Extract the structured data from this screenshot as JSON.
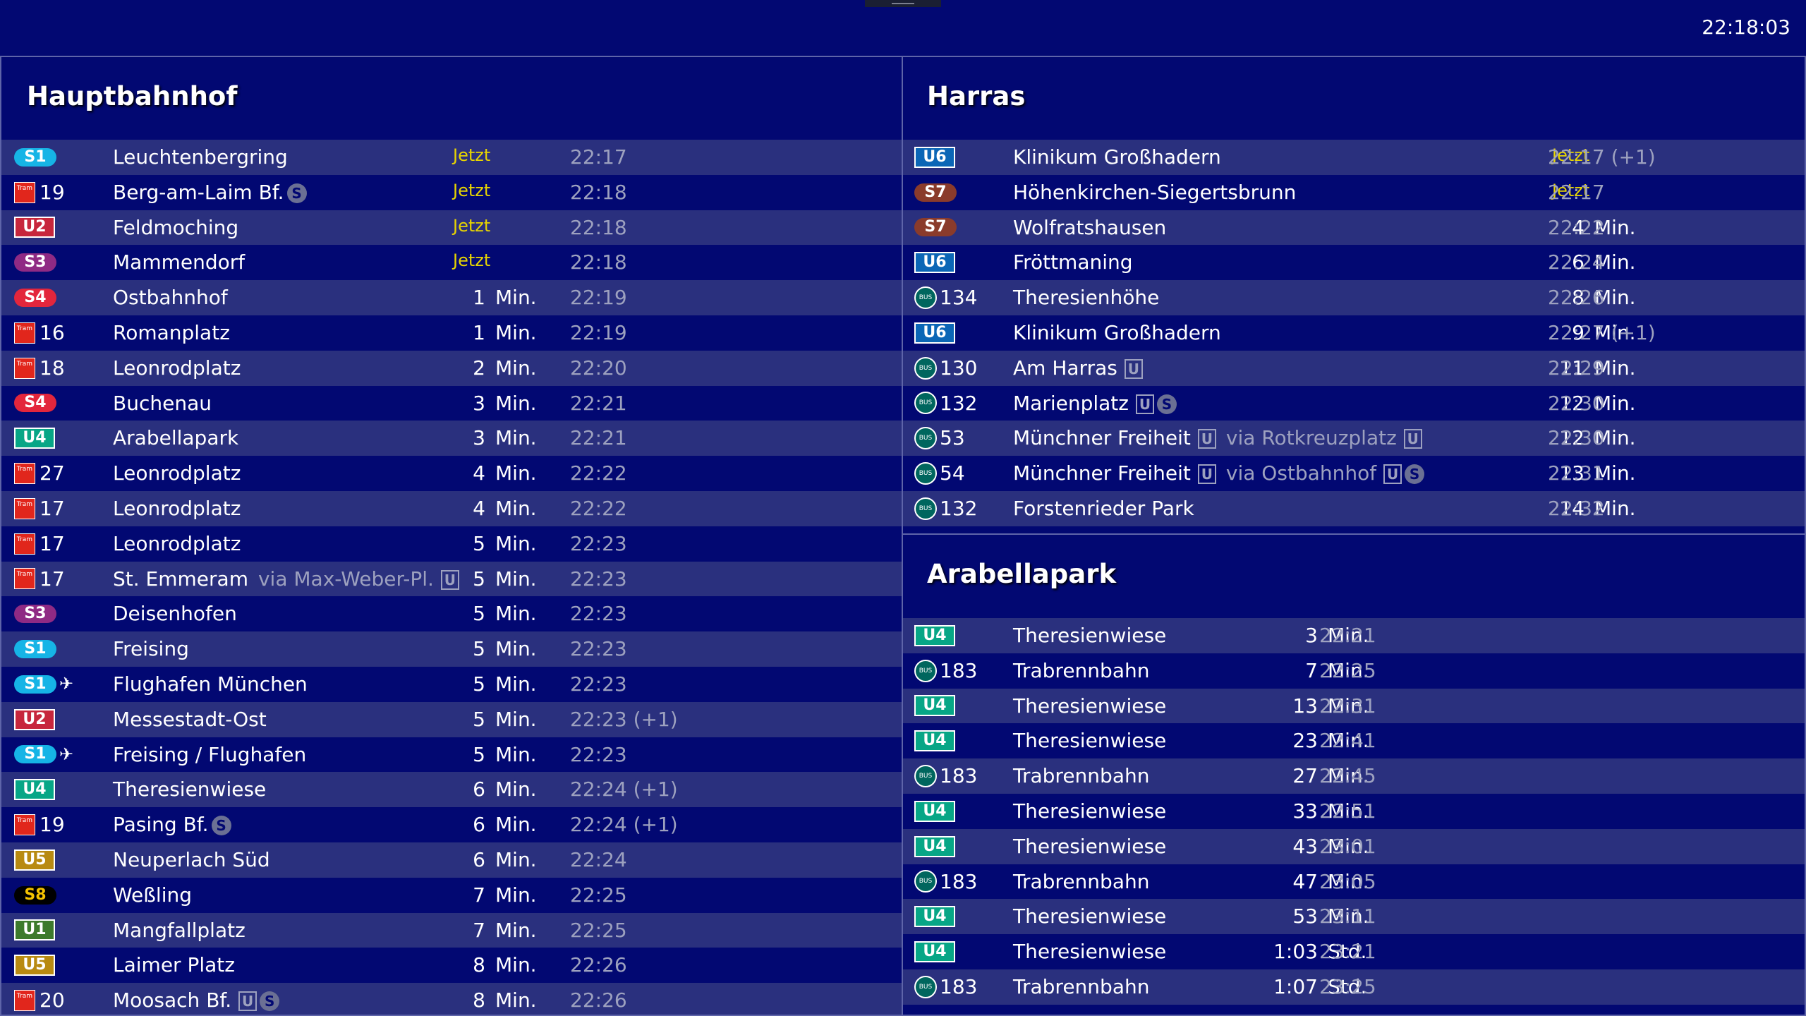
{
  "clock": "22:18:03",
  "colors": {
    "background": "#020872",
    "row_alt": "#2a307e",
    "jetzt": "#e8d500",
    "S1": "#16b4e6",
    "S2": "#6ab42d",
    "S3": "#8f2a84",
    "S4": "#e3263c",
    "S7": "#8a3b2b",
    "S8": "#000000",
    "U1": "#3d7a2c",
    "U2": "#c7263c",
    "U4": "#07a686",
    "U5": "#b88a12",
    "U6": "#0b66b6",
    "tram": "#e1261c",
    "bus": "#00665e"
  },
  "panels": [
    {
      "title": "Hauptbahnhof",
      "rows": [
        {
          "type": "s",
          "line": "S1",
          "dest": "Leuchtenbergring",
          "mins": "",
          "jetzt": "Jetzt",
          "unit": "",
          "time": "22:17"
        },
        {
          "type": "tram",
          "line": "19",
          "dest": "Berg-am-Laim Bf.",
          "icons": [
            "s"
          ],
          "mins": "",
          "jetzt": "Jetzt",
          "unit": "",
          "time": "22:18"
        },
        {
          "type": "u",
          "line": "U2",
          "dest": "Feldmoching",
          "mins": "",
          "jetzt": "Jetzt",
          "unit": "",
          "time": "22:18"
        },
        {
          "type": "s",
          "line": "S3",
          "dest": "Mammendorf",
          "mins": "",
          "jetzt": "Jetzt",
          "unit": "",
          "time": "22:18"
        },
        {
          "type": "s",
          "line": "S4",
          "dest": "Ostbahnhof",
          "mins": "1",
          "unit": "Min.",
          "time": "22:19"
        },
        {
          "type": "tram",
          "line": "16",
          "dest": "Romanplatz",
          "mins": "1",
          "unit": "Min.",
          "time": "22:19"
        },
        {
          "type": "tram",
          "line": "18",
          "dest": "Leonrodplatz",
          "mins": "2",
          "unit": "Min.",
          "time": "22:20"
        },
        {
          "type": "s",
          "line": "S4",
          "dest": "Buchenau",
          "mins": "3",
          "unit": "Min.",
          "time": "22:21"
        },
        {
          "type": "u",
          "line": "U4",
          "dest": "Arabellapark",
          "mins": "3",
          "unit": "Min.",
          "time": "22:21"
        },
        {
          "type": "tram",
          "line": "27",
          "dest": "Leonrodplatz",
          "mins": "4",
          "unit": "Min.",
          "time": "22:22"
        },
        {
          "type": "tram",
          "line": "17",
          "dest": "Leonrodplatz",
          "mins": "4",
          "unit": "Min.",
          "time": "22:22"
        },
        {
          "type": "tram",
          "line": "17",
          "dest": "Leonrodplatz",
          "mins": "5",
          "unit": "Min.",
          "time": "22:23"
        },
        {
          "type": "tram",
          "line": "17",
          "dest": "St. Emmeram",
          "via": "via Max-Weber-Pl.",
          "via_icons": [
            "u"
          ],
          "mins": "5",
          "unit": "Min.",
          "time": "22:23"
        },
        {
          "type": "s",
          "line": "S3",
          "dest": "Deisenhofen",
          "mins": "5",
          "unit": "Min.",
          "time": "22:23"
        },
        {
          "type": "s",
          "line": "S1",
          "dest": "Freising",
          "mins": "5",
          "unit": "Min.",
          "time": "22:23"
        },
        {
          "type": "s",
          "line": "S1",
          "plane": "✈",
          "dest": "Flughafen München",
          "mins": "5",
          "unit": "Min.",
          "time": "22:23"
        },
        {
          "type": "u",
          "line": "U2",
          "dest": "Messestadt-Ost",
          "mins": "5",
          "unit": "Min.",
          "time": "22:23 (+1)"
        },
        {
          "type": "s",
          "line": "S1",
          "plane": "✈",
          "dest": "Freising / Flughafen",
          "mins": "5",
          "unit": "Min.",
          "time": "22:23"
        },
        {
          "type": "u",
          "line": "U4",
          "dest": "Theresienwiese",
          "mins": "6",
          "unit": "Min.",
          "time": "22:24 (+1)"
        },
        {
          "type": "tram",
          "line": "19",
          "dest": "Pasing Bf.",
          "icons": [
            "s"
          ],
          "mins": "6",
          "unit": "Min.",
          "time": "22:24 (+1)"
        },
        {
          "type": "u",
          "line": "U5",
          "dest": "Neuperlach Süd",
          "mins": "6",
          "unit": "Min.",
          "time": "22:24"
        },
        {
          "type": "s",
          "line": "S8",
          "dest": "Weßling",
          "mins": "7",
          "unit": "Min.",
          "time": "22:25"
        },
        {
          "type": "u",
          "line": "U1",
          "dest": "Mangfallplatz",
          "mins": "7",
          "unit": "Min.",
          "time": "22:25"
        },
        {
          "type": "u",
          "line": "U5",
          "dest": "Laimer Platz",
          "mins": "8",
          "unit": "Min.",
          "time": "22:26"
        },
        {
          "type": "tram",
          "line": "20",
          "dest": "Moosach Bf.",
          "icons": [
            "u",
            "s"
          ],
          "mins": "8",
          "unit": "Min.",
          "time": "22:26"
        }
      ]
    },
    {
      "title": "Harras",
      "rows": [
        {
          "type": "u",
          "line": "U6",
          "dest": "Klinikum Großhadern",
          "mins": "",
          "jetzt": "Jetzt",
          "unit": "",
          "time": "22:17 (+1)"
        },
        {
          "type": "s",
          "line": "S7",
          "dest": "Höhenkirchen-Siegertsbrunn",
          "mins": "",
          "jetzt": "Jetzt",
          "unit": "",
          "time": "22:17"
        },
        {
          "type": "s",
          "line": "S7",
          "dest": "Wolfratshausen",
          "mins": "4",
          "unit": "Min.",
          "time": "22:22"
        },
        {
          "type": "u",
          "line": "U6",
          "dest": "Fröttmaning",
          "mins": "6",
          "unit": "Min.",
          "time": "22:24"
        },
        {
          "type": "bus",
          "line": "134",
          "dest": "Theresienhöhe",
          "mins": "8",
          "unit": "Min.",
          "time": "22:26"
        },
        {
          "type": "u",
          "line": "U6",
          "dest": "Klinikum Großhadern",
          "mins": "9",
          "unit": "Min.",
          "time": "22:27 (+1)"
        },
        {
          "type": "bus",
          "line": "130",
          "dest": "Am Harras",
          "icons": [
            "u"
          ],
          "mins": "11",
          "unit": "Min.",
          "time": "22:29"
        },
        {
          "type": "bus",
          "line": "132",
          "dest": "Marienplatz",
          "icons": [
            "u",
            "s"
          ],
          "mins": "12",
          "unit": "Min.",
          "time": "22:30"
        },
        {
          "type": "bus",
          "line": "53",
          "dest": "Münchner Freiheit",
          "icons": [
            "u"
          ],
          "via": "via Rotkreuzplatz",
          "via_icons": [
            "u"
          ],
          "mins": "12",
          "unit": "Min.",
          "time": "22:30"
        },
        {
          "type": "bus",
          "line": "54",
          "dest": "Münchner Freiheit",
          "icons": [
            "u"
          ],
          "via": "via Ostbahnhof",
          "via_icons": [
            "u",
            "s"
          ],
          "mins": "13",
          "unit": "Min.",
          "time": "22:31"
        },
        {
          "type": "bus",
          "line": "132",
          "dest": "Forstenrieder Park",
          "mins": "14",
          "unit": "Min.",
          "time": "22:32"
        }
      ]
    },
    {
      "title": "Arabellapark",
      "rows": [
        {
          "type": "u",
          "line": "U4",
          "dest": "Theresienwiese",
          "mins": "3",
          "unit": "Min.",
          "time": "22:21"
        },
        {
          "type": "bus",
          "line": "183",
          "dest": "Trabrennbahn",
          "mins": "7",
          "unit": "Min.",
          "time": "22:25"
        },
        {
          "type": "u",
          "line": "U4",
          "dest": "Theresienwiese",
          "mins": "13",
          "unit": "Min.",
          "time": "22:31"
        },
        {
          "type": "u",
          "line": "U4",
          "dest": "Theresienwiese",
          "mins": "23",
          "unit": "Min.",
          "time": "22:41"
        },
        {
          "type": "bus",
          "line": "183",
          "dest": "Trabrennbahn",
          "mins": "27",
          "unit": "Min.",
          "time": "22:45"
        },
        {
          "type": "u",
          "line": "U4",
          "dest": "Theresienwiese",
          "mins": "33",
          "unit": "Min.",
          "time": "22:51"
        },
        {
          "type": "u",
          "line": "U4",
          "dest": "Theresienwiese",
          "mins": "43",
          "unit": "Min.",
          "time": "23:01"
        },
        {
          "type": "bus",
          "line": "183",
          "dest": "Trabrennbahn",
          "mins": "47",
          "unit": "Min.",
          "time": "23:05"
        },
        {
          "type": "u",
          "line": "U4",
          "dest": "Theresienwiese",
          "mins": "53",
          "unit": "Min.",
          "time": "23:11"
        },
        {
          "type": "u",
          "line": "U4",
          "dest": "Theresienwiese",
          "mins": "1:03",
          "unit": "Std.",
          "time": "23:21"
        },
        {
          "type": "bus",
          "line": "183",
          "dest": "Trabrennbahn",
          "mins": "1:07",
          "unit": "Std.",
          "time": "23:25"
        }
      ]
    }
  ],
  "icon_labels": {
    "tram": "Tram",
    "bus": "BUS",
    "u": "U",
    "s": "S"
  }
}
